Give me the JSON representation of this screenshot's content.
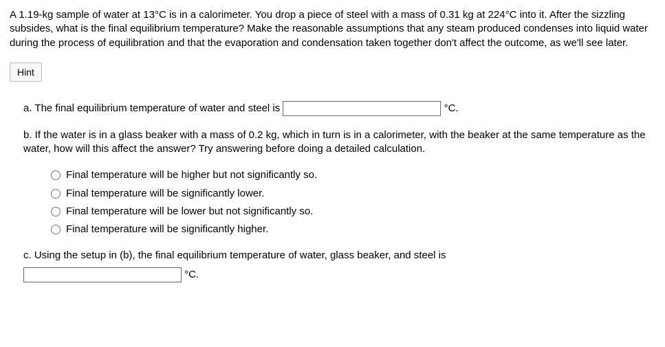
{
  "problem": {
    "text": "A 1.19-kg sample of water at 13°C is in a calorimeter. You drop a piece of steel with a mass of 0.31 kg at 224°C into it. After the sizzling subsides, what is the final equilibrium temperature? Make the reasonable assumptions that any steam produced condenses into liquid water during the process of equilibration and that the evaporation and condensation taken together don't affect the outcome, as we'll see later."
  },
  "hint_label": "Hint",
  "part_a": {
    "prefix": "a. The final equilibrium temperature of water and steel is ",
    "value": "",
    "unit": "°C."
  },
  "part_b": {
    "text": "b. If the water is in a glass beaker with a mass of 0.2 kg, which in turn is in a calorimeter, with the beaker at the same temperature as the water, how will this affect the answer? Try answering before doing a detailed calculation.",
    "options": [
      "Final temperature will be higher but not significantly so.",
      "Final temperature will be significantly lower.",
      "Final temperature will be lower but not significantly so.",
      "Final temperature will be significantly higher."
    ]
  },
  "part_c": {
    "text": "c. Using the setup in (b), the final equilibrium temperature of water, glass beaker, and steel is",
    "value": "",
    "unit": "°C."
  }
}
